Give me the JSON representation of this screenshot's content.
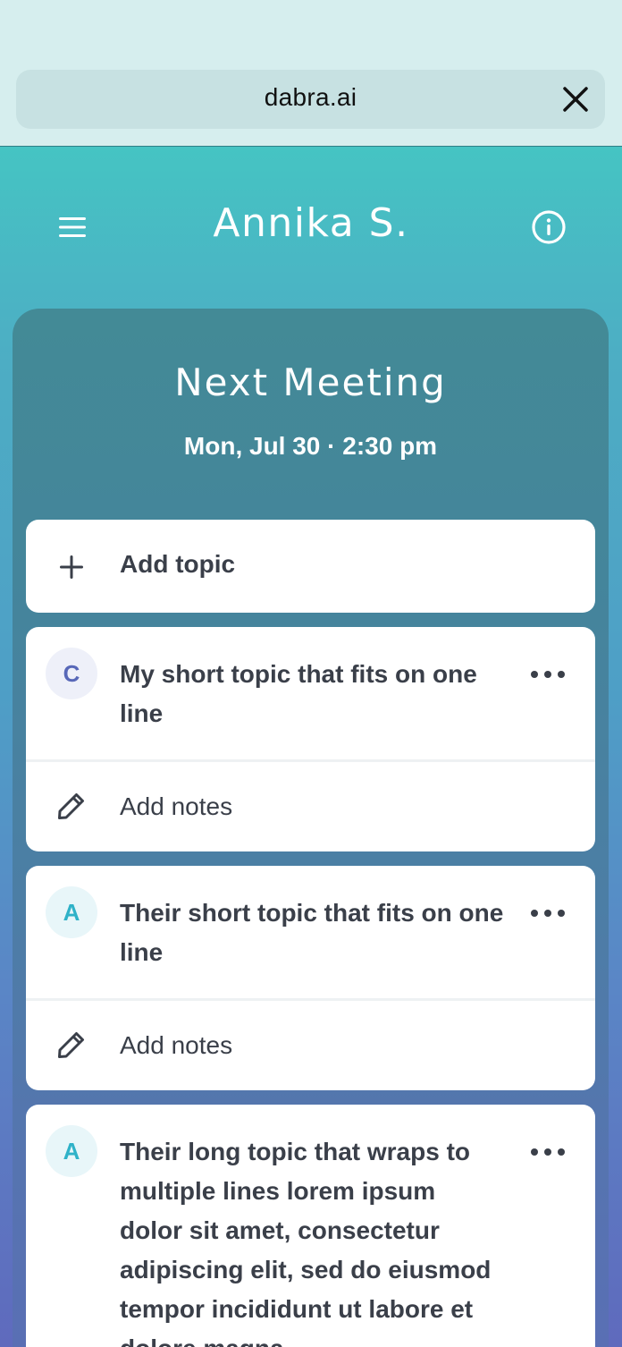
{
  "browser": {
    "url": "dabra.ai",
    "close_icon": "close-icon"
  },
  "header": {
    "title": "Annika S.",
    "menu_icon": "hamburger-menu-icon",
    "info_icon": "info-icon"
  },
  "meeting": {
    "title": "Next Meeting",
    "date": "Mon, Jul 30 · 2:30 pm"
  },
  "add_topic": {
    "label": "Add topic",
    "icon": "plus-icon"
  },
  "topics": [
    {
      "avatar_letter": "C",
      "text": "My short topic that fits on one line",
      "notes_label": "Add notes"
    },
    {
      "avatar_letter": "A",
      "text": "Their short topic that fits on one line",
      "notes_label": "Add notes"
    },
    {
      "avatar_letter": "A",
      "text": "Their long topic that wraps to multiple lines lorem ipsum dolor sit amet, consectetur adipiscing elit, sed do eiusmod tempor incididunt ut labore et dolore magna"
    }
  ],
  "colors": {
    "accent_teal": "#45c4c3",
    "accent_purple": "#5f6abd",
    "text_dark": "#3a3f49",
    "avatar_c": "#5868b8",
    "avatar_a": "#2fb2c8"
  }
}
